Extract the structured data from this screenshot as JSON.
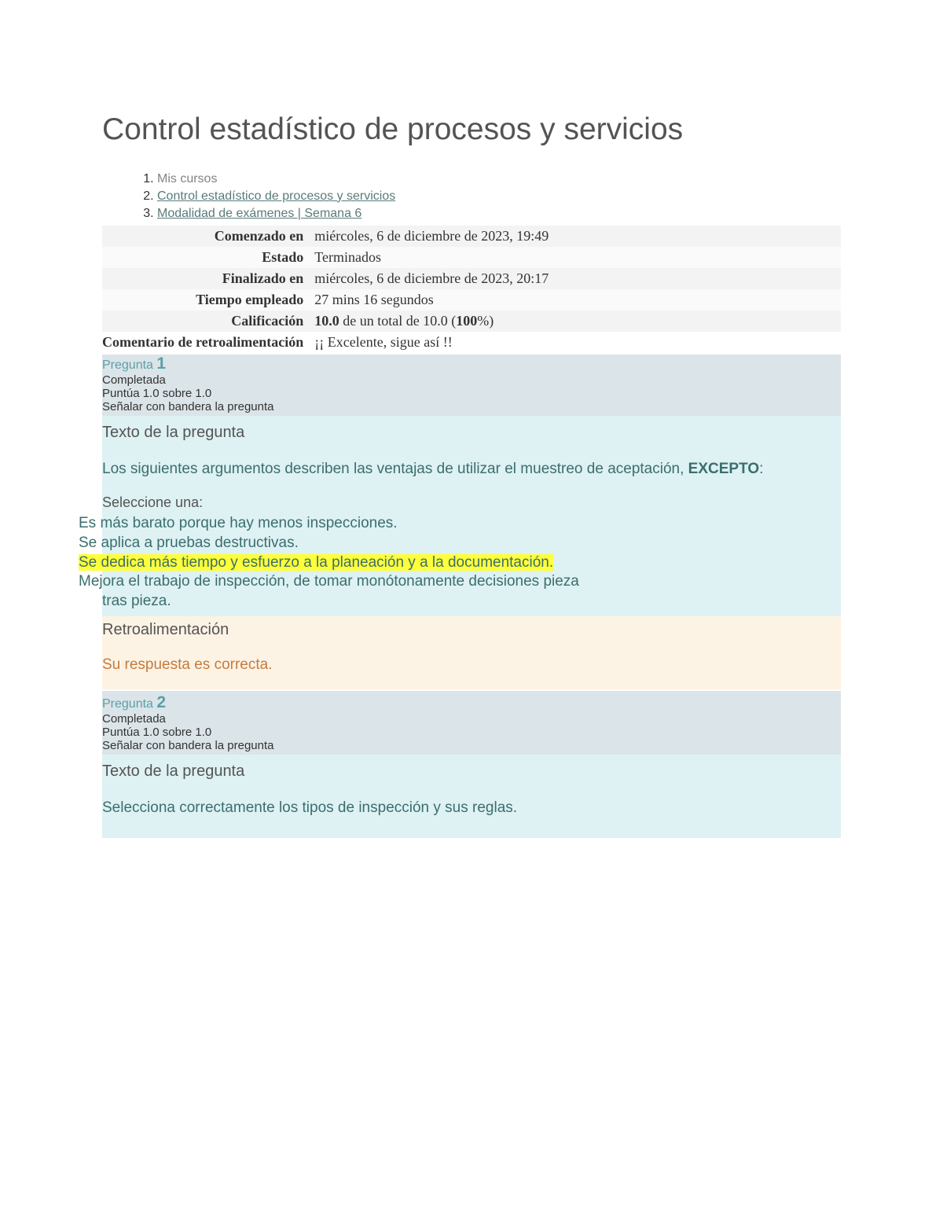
{
  "title": "Control estadístico de procesos y servicios",
  "breadcrumb": {
    "items": [
      {
        "label": "Mis cursos",
        "link": false
      },
      {
        "label": "Control estadístico de procesos y servicios",
        "link": true
      },
      {
        "label": "Modalidad de exámenes | Semana 6",
        "link": true
      }
    ]
  },
  "summary": {
    "rows": [
      {
        "label": "Comenzado en",
        "value": "miércoles, 6 de diciembre de 2023, 19:49"
      },
      {
        "label": "Estado",
        "value": "Terminados"
      },
      {
        "label": "Finalizado en",
        "value": "miércoles, 6 de diciembre de 2023, 20:17"
      },
      {
        "label": "Tiempo empleado",
        "value": "27 mins 16 segundos"
      }
    ],
    "grade_label": "Calificación",
    "grade_earned": "10.0",
    "grade_of": " de un total de 10.0 (",
    "grade_pct": "100",
    "grade_close": "%)",
    "feedback_label": "Comentario de retroalimentación",
    "feedback_value": "¡¡ Excelente, sigue así !!"
  },
  "q1": {
    "label_prefix": "Pregunta ",
    "number": "1",
    "state": "Completada",
    "mark": "Puntúa 1.0 sobre 1.0",
    "flag": "Señalar con bandera la pregunta",
    "heading": "Texto de la pregunta",
    "text_pre": "Los siguientes argumentos describen las ventajas de utilizar el muestreo de aceptación, ",
    "text_bold": "EXCEPTO",
    "text_post": ":",
    "select_one": "Seleccione una:",
    "answers": [
      "Es más barato porque hay menos inspecciones.",
      "Se aplica a pruebas destructivas.",
      "Se dedica más tiempo y esfuerzo a la planeación y a la documentación.",
      "Mejora el trabajo de inspección, de tomar monótonamente decisiones pieza",
      "tras pieza."
    ],
    "fb_heading": "Retroalimentación",
    "fb_text": "Su respuesta es correcta."
  },
  "q2": {
    "label_prefix": "Pregunta ",
    "number": "2",
    "state": "Completada",
    "mark": "Puntúa 1.0 sobre 1.0",
    "flag": "Señalar con bandera la pregunta",
    "heading": "Texto de la pregunta",
    "text": "Selecciona correctamente los tipos de inspección y sus reglas."
  }
}
